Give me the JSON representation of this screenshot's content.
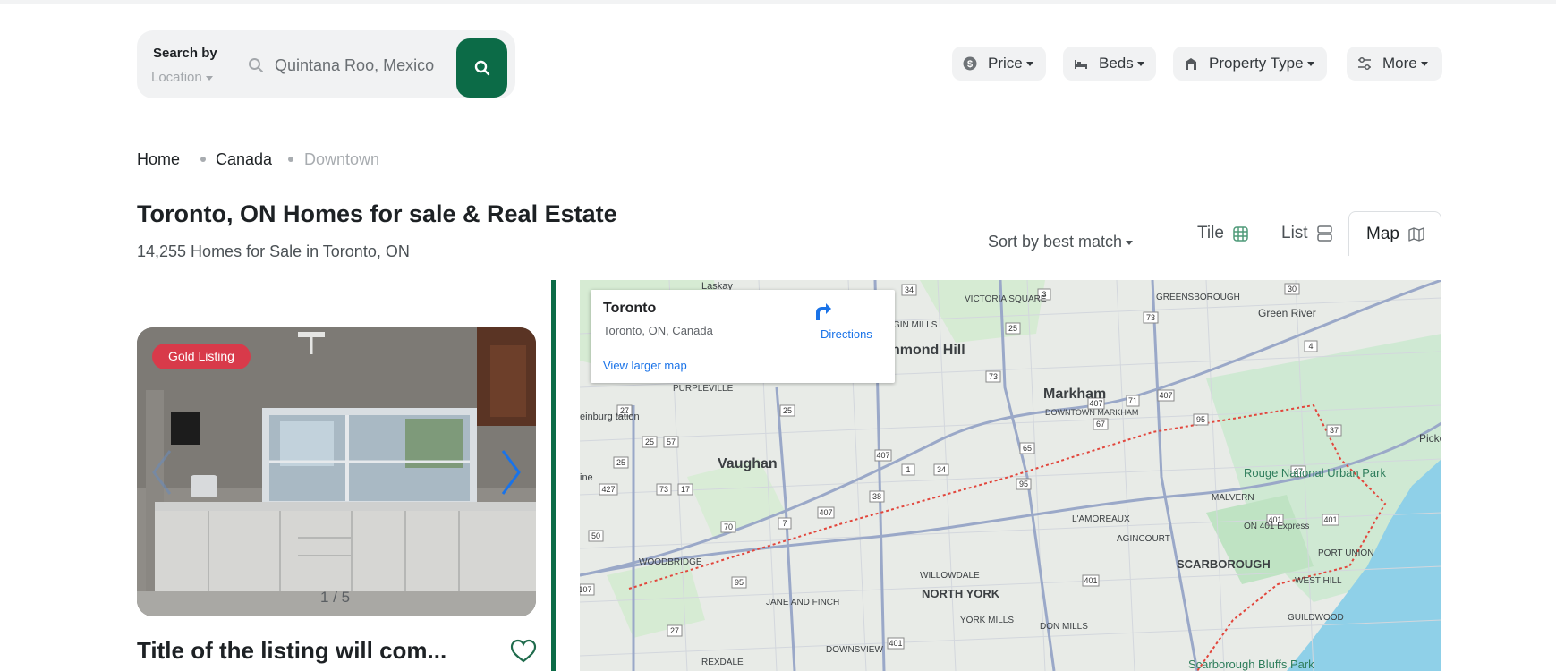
{
  "search": {
    "by_label": "Search by",
    "mode_label": "Location",
    "placeholder": "Quintana Roo, Mexico"
  },
  "filters": [
    {
      "label": "Price",
      "icon": "dollar-icon"
    },
    {
      "label": "Beds",
      "icon": "bed-icon"
    },
    {
      "label": "Property Type",
      "icon": "house-icon"
    },
    {
      "label": "More",
      "icon": "sliders-icon"
    }
  ],
  "breadcrumb": [
    "Home",
    "Canada",
    "Downtown"
  ],
  "page": {
    "title": "Toronto, ON Homes for sale & Real Estate",
    "subtitle": "14,255 Homes for Sale in Toronto, ON"
  },
  "sort_label": "Sort by best match",
  "view_tabs": [
    {
      "label": "Tile",
      "icon": "grid-icon",
      "active": false
    },
    {
      "label": "List",
      "icon": "list-icon",
      "active": false
    },
    {
      "label": "Map",
      "icon": "map-icon",
      "active": true
    }
  ],
  "listing": {
    "badge": "Gold Listing",
    "counter": "1 / 5",
    "title": "Title of the listing will com..."
  },
  "map": {
    "place_name": "Toronto",
    "place_address": "Toronto, ON, Canada",
    "directions_label": "Directions",
    "larger_map_label": "View larger map",
    "labels": {
      "richmond_hill": "hmond Hill",
      "markham": "Markham",
      "downtown_markham": "DOWNTOWN MARKHAM",
      "vaughan": "Vaughan",
      "north_york": "NORTH YORK",
      "scarborough": "SCARBOROUGH",
      "rouge": "Rouge National Urban Park",
      "malvern": "MALVERN",
      "lamoureaux": "L'AMOREAUX",
      "agincourt": "AGINCOURT",
      "willowdale": "WILLOWDALE",
      "woodbridge": "WOODBRIDGE",
      "jane_finch": "JANE AND FINCH",
      "york_mills": "YORK MILLS",
      "don_mills": "DON MILLS",
      "downsview": "DOWNSVIEW",
      "rexdale": "REXDALE",
      "guildwood": "GUILDWOOD",
      "port_union": "PORT UNION",
      "west_hill": "WEST HILL",
      "greensborough": "GREENSBOROUGH",
      "green_river": "Green River",
      "victoria_square": "VICTORIA SQUARE",
      "purpleville": "PURPLEVILLE",
      "gin_mills": "GIN MILLS",
      "laskay": "Laskay",
      "pickering": "Picke",
      "kleinburg": "einburg tation",
      "ine": "ine",
      "scarborough_bluffs": "Scarborough Bluffs Park",
      "on401": "ON 401 Express"
    }
  }
}
